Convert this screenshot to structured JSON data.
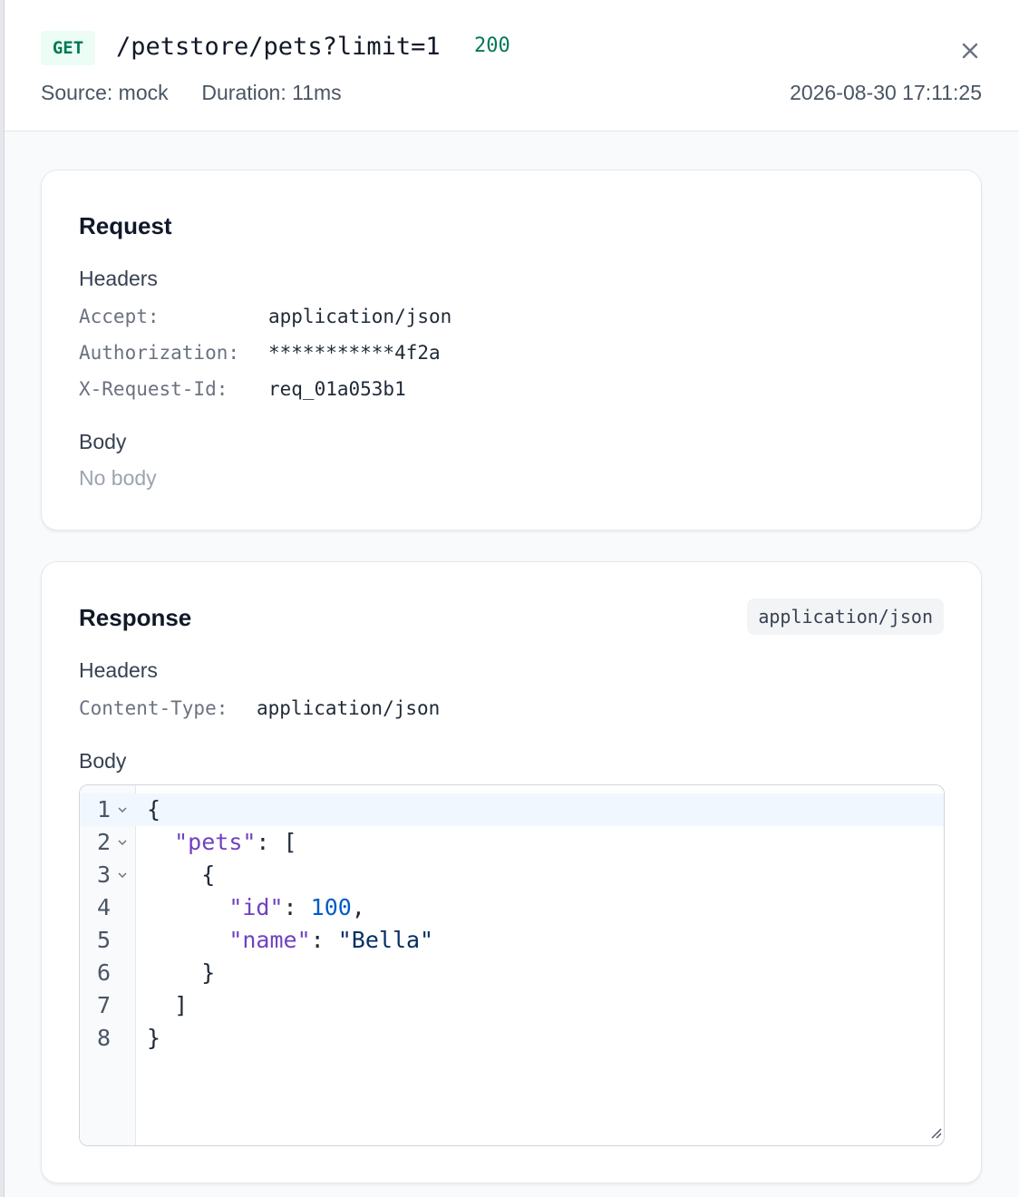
{
  "header": {
    "method": "GET",
    "path": "/petstore/pets?limit=1",
    "status": "200",
    "source_label": "Source:",
    "source_value": "mock",
    "duration_label": "Duration:",
    "duration_value": "11ms",
    "timestamp": "2026-08-30 17:11:25",
    "close_icon": "close-icon"
  },
  "request": {
    "title": "Request",
    "headers_label": "Headers",
    "headers": [
      {
        "key": "Accept:",
        "value": "application/json"
      },
      {
        "key": "Authorization:",
        "value": "***********4f2a"
      },
      {
        "key": "X-Request-Id:",
        "value": "req_01a053b1"
      }
    ],
    "body_label": "Body",
    "body_empty": "No body"
  },
  "response": {
    "title": "Response",
    "content_type_badge": "application/json",
    "headers_label": "Headers",
    "headers": [
      {
        "key": "Content-Type:",
        "value": "application/json"
      }
    ],
    "body_label": "Body",
    "code_lines": [
      {
        "number": "1",
        "foldable": true,
        "text": "{"
      },
      {
        "number": "2",
        "foldable": true,
        "text": "  \"pets\": ["
      },
      {
        "number": "3",
        "foldable": true,
        "text": "    {"
      },
      {
        "number": "4",
        "foldable": false,
        "text": "      \"id\": 100,"
      },
      {
        "number": "5",
        "foldable": false,
        "text": "      \"name\": \"Bella\""
      },
      {
        "number": "6",
        "foldable": false,
        "text": "    }"
      },
      {
        "number": "7",
        "foldable": false,
        "text": "  ]"
      },
      {
        "number": "8",
        "foldable": false,
        "text": "}"
      }
    ],
    "code_tokens": {
      "l1": {
        "punc": "{"
      },
      "l2": {
        "key": "\"pets\"",
        "punc": ": ["
      },
      "l3": {
        "punc": "{"
      },
      "l4": {
        "key": "\"id\"",
        "colon": ": ",
        "num": "100",
        "comma": ","
      },
      "l5": {
        "key": "\"name\"",
        "colon": ": ",
        "str": "\"Bella\""
      },
      "l6": {
        "punc": "}"
      },
      "l7": {
        "punc": "]"
      },
      "l8": {
        "punc": "}"
      }
    },
    "fold_icon": "chevron-down-icon",
    "resize_icon": "resize-grip-icon"
  },
  "colors": {
    "method_bg": "#ecfdf5",
    "method_fg": "#047857",
    "status_ok": "#047857",
    "json_key": "#6f42c1",
    "json_number": "#005cc5",
    "json_string": "#032f62"
  }
}
